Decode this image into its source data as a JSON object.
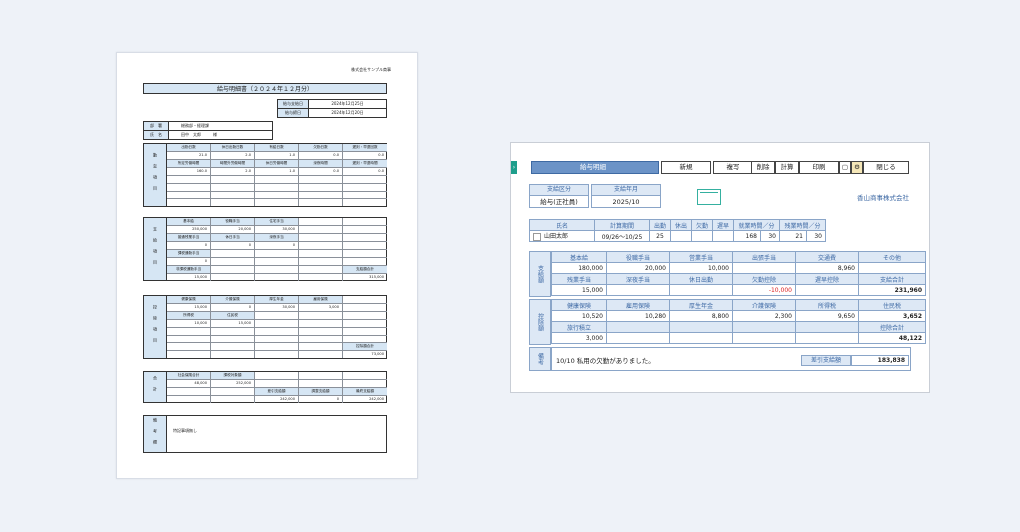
{
  "paper": {
    "company": "株式会社サンプル商事",
    "title": "給与明細書（２０２４年１２月分）",
    "dates": [
      {
        "label": "給与支給日",
        "value": "2024年12月25日"
      },
      {
        "label": "給与締日",
        "value": "2024年12月20日"
      }
    ],
    "info": [
      {
        "label": "部　署",
        "value": "総務部・経理課"
      },
      {
        "label": "氏　名",
        "value": "田中　太郎　　　様"
      }
    ],
    "attendance": {
      "side": "勤怠項目",
      "rows": [
        [
          "出勤日数",
          "休日出勤日数",
          "有給日数",
          "欠勤日数",
          "遅刻・早退回数"
        ],
        [
          "21.0",
          "2.0",
          "1.0",
          "0.0",
          "0.0"
        ],
        [
          "所定労働時間",
          "時間外労働時間",
          "休日労働時間",
          "深夜時間",
          "遅刻・早退時間"
        ],
        [
          "160.0",
          "2.0",
          "1.0",
          "0.0",
          "0.0"
        ],
        [
          "",
          "",
          "",
          "",
          ""
        ],
        [
          "",
          "",
          "",
          "",
          ""
        ],
        [
          "",
          "",
          "",
          "",
          ""
        ],
        [
          "",
          "",
          "",
          "",
          ""
        ]
      ]
    },
    "payment": {
      "side": "支給項目",
      "rows": [
        [
          "基本給",
          "役職手当",
          "住宅手当",
          "",
          ""
        ],
        [
          "250,000",
          "20,000",
          "30,000",
          "",
          ""
        ],
        [
          "普通残業手当",
          "休日手当",
          "深夜手当",
          "",
          ""
        ],
        [
          "0",
          "0",
          "0",
          "",
          ""
        ],
        [
          "課税通勤手当",
          "",
          "",
          "",
          ""
        ],
        [
          "0",
          "",
          "",
          "",
          ""
        ],
        [
          "非課税通勤手当",
          "",
          "",
          "",
          "支給額合計"
        ],
        [
          "15,000",
          "",
          "",
          "",
          "315,000"
        ]
      ]
    },
    "deduction": {
      "side": "控除項目",
      "rows": [
        [
          "健康保険",
          "介護保険",
          "厚生年金",
          "雇用保険",
          ""
        ],
        [
          "15,000",
          "0",
          "30,000",
          "3,000",
          ""
        ],
        [
          "所得税",
          "住民税",
          "",
          "",
          ""
        ],
        [
          "10,000",
          "15,000",
          "",
          "",
          ""
        ],
        [
          "",
          "",
          "",
          "",
          ""
        ],
        [
          "",
          "",
          "",
          "",
          ""
        ],
        [
          "",
          "",
          "",
          "",
          "控除額合計"
        ],
        [
          "",
          "",
          "",
          "",
          "73,000"
        ]
      ]
    },
    "totals": {
      "side": "合計",
      "rows": [
        [
          "社会保険合計",
          "課税対象額",
          "",
          "",
          ""
        ],
        [
          "48,000",
          "252,000",
          "",
          "",
          ""
        ],
        [
          "",
          "",
          "差引支給額",
          "調整支給額",
          "最終支給額"
        ],
        [
          "",
          "",
          "242,000",
          "0",
          "242,000"
        ]
      ]
    },
    "notes": {
      "side": "備考欄",
      "text": "特記事項無し"
    }
  },
  "app": {
    "window_title": "給与明細",
    "toolbar": [
      "新規",
      "複写",
      "削除",
      "計算",
      "印刷",
      "閉じる"
    ],
    "pay_type_label": "支給区分",
    "pay_type_value": "給与(正社員)",
    "pay_month_label": "支給年月",
    "pay_month_value": "2025/10",
    "company": "香山商事株式会社",
    "att_headers": [
      "氏名",
      "計算期間",
      "出勤",
      "休出",
      "欠勤",
      "遅早",
      "就業時間／分",
      "残業時間／分"
    ],
    "att_values": {
      "name": "山田太郎",
      "period": "09/26～10/25",
      "days": "25",
      "holiday": "",
      "absent": "",
      "late": "",
      "work_h": "168",
      "work_m": "30",
      "ot_h": "21",
      "ot_m": "30"
    },
    "pay_side": "支給額",
    "pay_headers1": [
      "基本給",
      "役職手当",
      "営業手当",
      "出張手当",
      "交通費",
      "その他"
    ],
    "pay_values1": [
      "180,000",
      "20,000",
      "10,000",
      "",
      "8,960",
      ""
    ],
    "pay_headers2": [
      "残業手当",
      "深夜手当",
      "休日出勤",
      "欠勤控除",
      "遅早控除",
      "支給合計"
    ],
    "pay_values2": [
      "15,000",
      "",
      "",
      "-10,000",
      "",
      "231,960"
    ],
    "ded_side": "控除額",
    "ded_headers1": [
      "健康保険",
      "雇用保険",
      "厚生年金",
      "介護保険",
      "所得税",
      "住民税"
    ],
    "ded_values1": [
      "10,520",
      "10,280",
      "8,800",
      "2,300",
      "9,650",
      "3,652"
    ],
    "ded_headers2": [
      "旅行積立",
      "",
      "",
      "",
      "",
      "控除合計"
    ],
    "ded_values2": [
      "3,000",
      "",
      "",
      "",
      "",
      "48,122"
    ],
    "note_side": "備考",
    "note_text": "10/10 私用の欠勤がありました。",
    "net_label": "差引支給額",
    "net_value": "183,838",
    "colors": {
      "accent": "#6b93c7",
      "label_bg": "#dde8f5",
      "arrow": "#1e9e8c"
    }
  }
}
